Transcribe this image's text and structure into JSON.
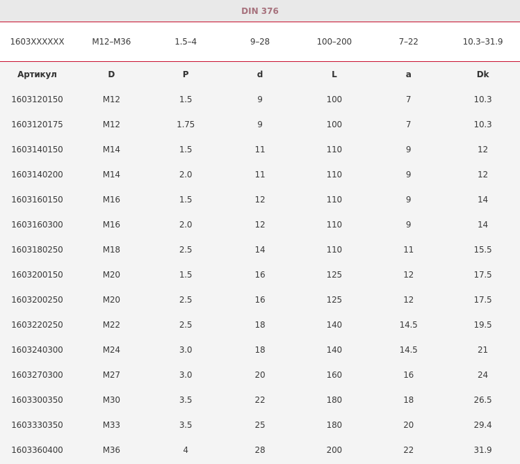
{
  "table": {
    "title": "DIN 376",
    "summary": [
      "1603XXXXXX",
      "M12–M36",
      "1.5–4",
      "9–28",
      "100–200",
      "7–22",
      "10.3–31.9"
    ],
    "columns": [
      "Артикул",
      "D",
      "P",
      "d",
      "L",
      "a",
      "Dk"
    ],
    "rows": [
      [
        "1603120150",
        "M12",
        "1.5",
        "9",
        "100",
        "7",
        "10.3"
      ],
      [
        "1603120175",
        "M12",
        "1.75",
        "9",
        "100",
        "7",
        "10.3"
      ],
      [
        "1603140150",
        "M14",
        "1.5",
        "11",
        "110",
        "9",
        "12"
      ],
      [
        "1603140200",
        "M14",
        "2.0",
        "11",
        "110",
        "9",
        "12"
      ],
      [
        "1603160150",
        "M16",
        "1.5",
        "12",
        "110",
        "9",
        "14"
      ],
      [
        "1603160300",
        "M16",
        "2.0",
        "12",
        "110",
        "9",
        "14"
      ],
      [
        "1603180250",
        "M18",
        "2.5",
        "14",
        "110",
        "11",
        "15.5"
      ],
      [
        "1603200150",
        "M20",
        "1.5",
        "16",
        "125",
        "12",
        "17.5"
      ],
      [
        "1603200250",
        "M20",
        "2.5",
        "16",
        "125",
        "12",
        "17.5"
      ],
      [
        "1603220250",
        "M22",
        "2.5",
        "18",
        "140",
        "14.5",
        "19.5"
      ],
      [
        "1603240300",
        "M24",
        "3.0",
        "18",
        "140",
        "14.5",
        "21"
      ],
      [
        "1603270300",
        "M27",
        "3.0",
        "20",
        "160",
        "16",
        "24"
      ],
      [
        "1603300350",
        "M30",
        "3.5",
        "22",
        "180",
        "18",
        "26.5"
      ],
      [
        "1603330350",
        "M33",
        "3.5",
        "25",
        "180",
        "20",
        "29.4"
      ],
      [
        "1603360400",
        "M36",
        "4",
        "28",
        "200",
        "22",
        "31.9"
      ]
    ]
  },
  "colors": {
    "accent": "#c8102e",
    "title_text": "#a7727d",
    "background": "#f4f4f4"
  }
}
